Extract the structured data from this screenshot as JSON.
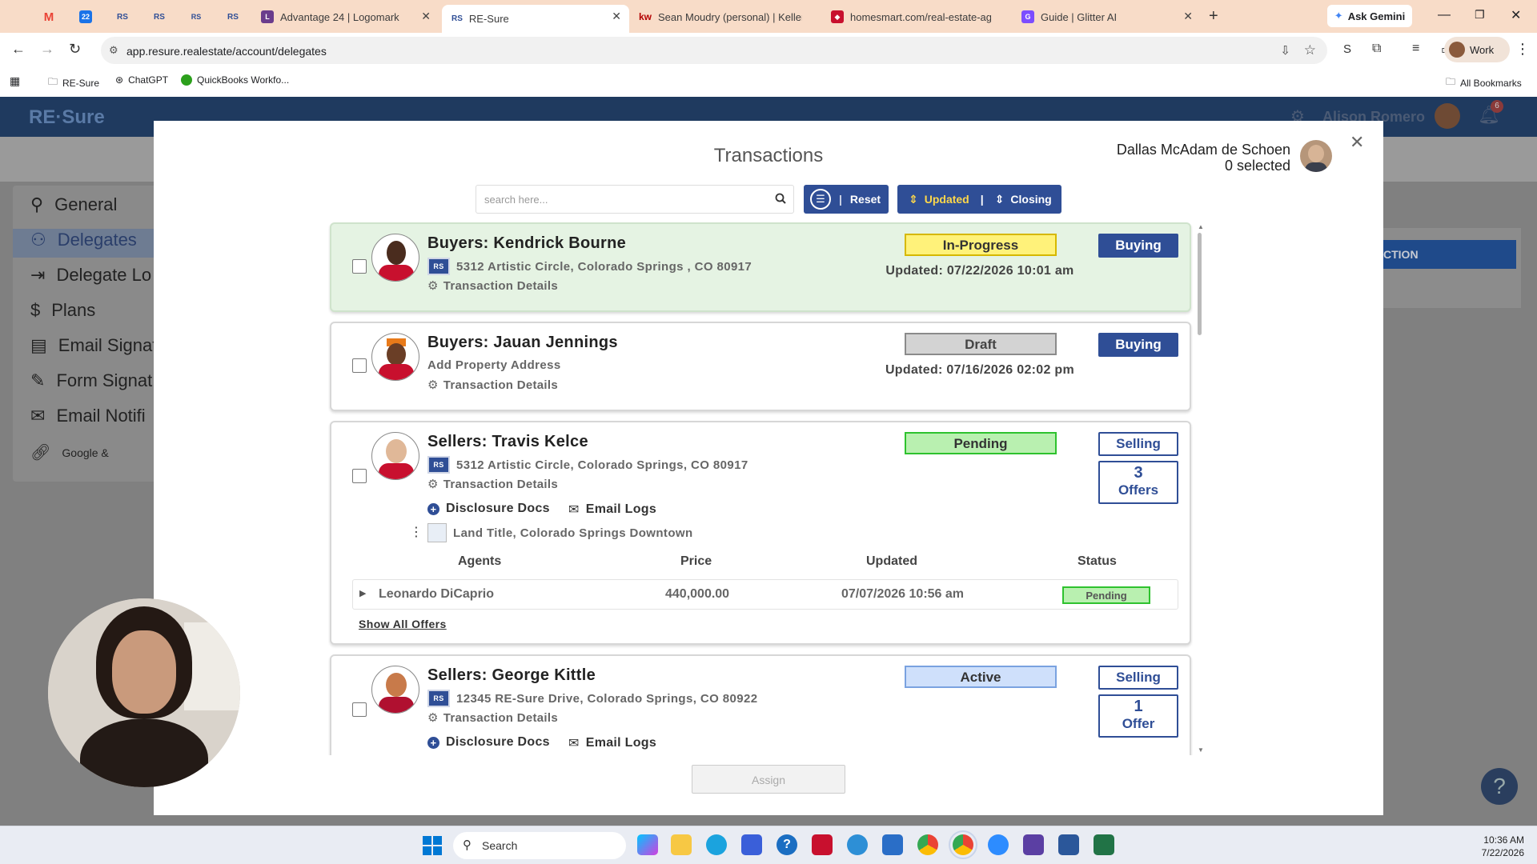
{
  "browser": {
    "tabs": [
      {
        "label": "",
        "icon": "gmail-icon",
        "color": "#ea4335"
      },
      {
        "label": "",
        "icon": "calendar-icon",
        "color": "#1a73e8"
      },
      {
        "label": "",
        "icon": "resure-icon",
        "color": "#2f4e96"
      },
      {
        "label": "",
        "icon": "resure-icon",
        "color": "#2f4e96"
      },
      {
        "label": "",
        "icon": "resure-icon",
        "color": "#2f4e96"
      },
      {
        "label": "",
        "icon": "resure-icon",
        "color": "#2f4e96"
      },
      {
        "label": "Advantage 24 | Logomark",
        "icon": "logomark-icon",
        "color": "#6a3c8c"
      },
      {
        "label": "RE-Sure",
        "icon": "resure-icon",
        "color": "#2f4e96"
      },
      {
        "label": "Sean Moudry (personal) | Keller",
        "icon": "kw-icon",
        "color": "#b40101"
      },
      {
        "label": "homesmart.com/real-estate-ag",
        "icon": "homesmart-icon",
        "color": "#c8102e"
      },
      {
        "label": "Guide | Glitter AI",
        "icon": "glitter-icon",
        "color": "#7c4dff"
      }
    ],
    "new_tab": "+",
    "ask_gemini": "Ask Gemini",
    "url": "app.resure.realestate/account/delegates",
    "profile": "Work",
    "bookmarks": [
      "RE-Sure",
      "ChatGPT",
      "QuickBooks Workfo..."
    ],
    "all_bookmarks": "All Bookmarks"
  },
  "app": {
    "logo": "RE·Sure",
    "user_name": "Alison Romero",
    "notif_count": "6",
    "sidebar": [
      {
        "label": "General",
        "icon": "person-icon"
      },
      {
        "label": "Delegates",
        "icon": "people-icon"
      },
      {
        "label": "Delegate Lo",
        "icon": "login-icon"
      },
      {
        "label": "Plans",
        "icon": "dollar-icon"
      },
      {
        "label": "Email Signat",
        "icon": "id-card-icon"
      },
      {
        "label": "Form Signat",
        "icon": "signature-icon"
      },
      {
        "label": "Email Notifi",
        "icon": "mail-icon"
      },
      {
        "label": "Google &",
        "icon": "link-icon"
      }
    ],
    "right_button": "CTION",
    "help": "?"
  },
  "modal": {
    "title": "Transactions",
    "user": "Dallas McAdam de Schoen",
    "selected": "0 selected",
    "search_placeholder": "search here...",
    "reset": "Reset",
    "sort_updated": "Updated",
    "sort_closing": "Closing",
    "assign": "Assign",
    "transactions": [
      {
        "title": "Buyers: Kendrick Bourne",
        "address": "5312 Artistic Circle, Colorado Springs , CO 80917",
        "details": "Transaction Details",
        "status": "In-Progress",
        "updated": "Updated: 07/22/2026 10:01 am",
        "role": "Buying"
      },
      {
        "title": "Buyers: Jauan Jennings",
        "address": "Add Property Address",
        "details": "Transaction Details",
        "status": "Draft",
        "updated": "Updated: 07/16/2026 02:02 pm",
        "role": "Buying"
      },
      {
        "title": "Sellers: Travis Kelce",
        "address": "5312 Artistic Circle, Colorado Springs, CO 80917",
        "details": "Transaction Details",
        "status": "Pending",
        "role": "Selling",
        "offers_count": "3",
        "offers_label": "Offers",
        "disclosure": "Disclosure Docs",
        "email_logs": "Email Logs",
        "title_co": "Land Title, Colorado Springs Downtown",
        "offer_headers": [
          "Agents",
          "Price",
          "Updated",
          "Status"
        ],
        "offer_row": {
          "agent": "Leonardo DiCaprio",
          "price": "440,000.00",
          "updated": "07/07/2026 10:56 am",
          "status": "Pending"
        },
        "show_all": "Show All Offers"
      },
      {
        "title": "Sellers: George Kittle",
        "address": "12345 RE-Sure Drive, Colorado Springs, CO 80922",
        "details": "Transaction Details",
        "status": "Active",
        "role": "Selling",
        "offers_count": "1",
        "offers_label": "Offer",
        "disclosure": "Disclosure Docs",
        "email_logs": "Email Logs"
      }
    ]
  },
  "taskbar": {
    "search": "Search",
    "time": "10:36 AM",
    "date": "7/22/2026"
  },
  "colors": {
    "tabbar": "#f8dcc8",
    "brand_blue": "#2f4e96",
    "in_progress": "#fff27a",
    "draft": "#d3d3d3",
    "pending": "#b9f0b0",
    "active": "#cfe0fb"
  }
}
